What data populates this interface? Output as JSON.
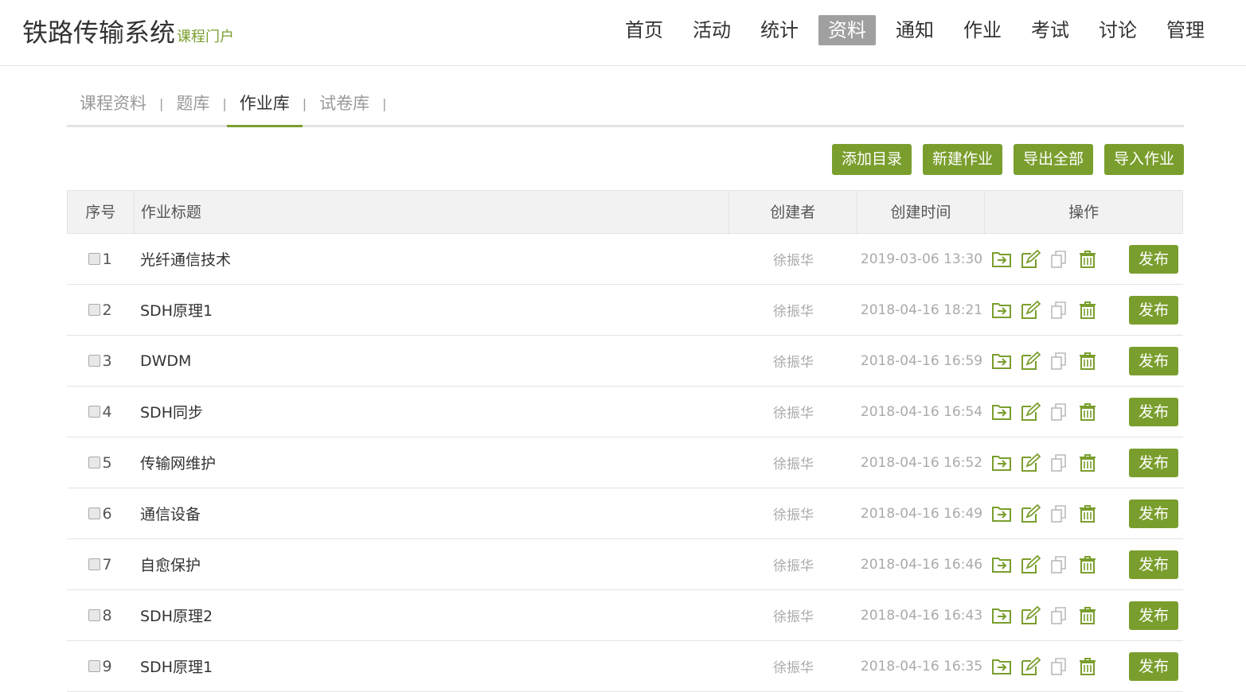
{
  "header": {
    "title": "铁路传输系统",
    "subtitle": "课程门户",
    "nav": [
      "首页",
      "活动",
      "统计",
      "资料",
      "通知",
      "作业",
      "考试",
      "讨论",
      "管理"
    ],
    "active_nav": "资料"
  },
  "subtabs": {
    "items": [
      "课程资料",
      "题库",
      "作业库",
      "试卷库"
    ],
    "active": "作业库",
    "separator": "|"
  },
  "toolbar": {
    "add_dir": "添加目录",
    "new_homework": "新建作业",
    "export_all": "导出全部",
    "import_homework": "导入作业"
  },
  "table": {
    "headers": {
      "idx": "序号",
      "title": "作业标题",
      "creator": "创建者",
      "time": "创建时间",
      "ops": "操作"
    },
    "publish_label": "发布",
    "rows": [
      {
        "idx": "1",
        "title": "光纤通信技术",
        "creator": "徐振华",
        "time": "2019-03-06 13:30"
      },
      {
        "idx": "2",
        "title": "SDH原理1",
        "creator": "徐振华",
        "time": "2018-04-16 18:21"
      },
      {
        "idx": "3",
        "title": "DWDM",
        "creator": "徐振华",
        "time": "2018-04-16 16:59"
      },
      {
        "idx": "4",
        "title": "SDH同步",
        "creator": "徐振华",
        "time": "2018-04-16 16:54"
      },
      {
        "idx": "5",
        "title": "传输网维护",
        "creator": "徐振华",
        "time": "2018-04-16 16:52"
      },
      {
        "idx": "6",
        "title": "通信设备",
        "creator": "徐振华",
        "time": "2018-04-16 16:49"
      },
      {
        "idx": "7",
        "title": "自愈保护",
        "creator": "徐振华",
        "time": "2018-04-16 16:46"
      },
      {
        "idx": "8",
        "title": "SDH原理2",
        "creator": "徐振华",
        "time": "2018-04-16 16:43"
      },
      {
        "idx": "9",
        "title": "SDH原理1",
        "creator": "徐振华",
        "time": "2018-04-16 16:35"
      }
    ]
  },
  "colors": {
    "accent": "#7a9e2d",
    "nav_active_bg": "#a0a0a0",
    "muted": "#aaaaaa"
  },
  "icons": [
    "move-icon",
    "edit-icon",
    "copy-icon",
    "delete-icon"
  ]
}
